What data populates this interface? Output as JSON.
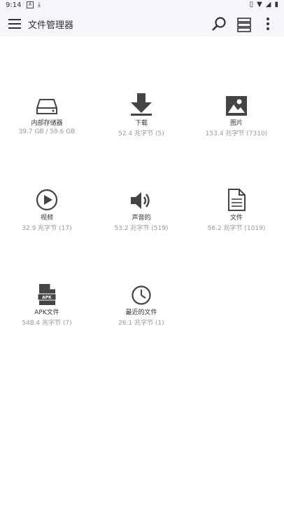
{
  "status": {
    "time": "9:14",
    "left_icons": [
      "a-badge-icon",
      "download-icon"
    ],
    "right_icons": [
      "vibrate-icon",
      "wifi-icon",
      "signal-icon",
      "battery-icon"
    ]
  },
  "appbar": {
    "title": "文件管理器",
    "icons": [
      "menu-icon",
      "search-icon",
      "layout-icon",
      "more-icon"
    ]
  },
  "tiles": [
    {
      "label": "内部存储器",
      "sub": "39.7 GB / 59.6 GB",
      "icon": "drive-icon"
    },
    {
      "label": "下载",
      "sub": "52.4 兆字节 (5)",
      "icon": "download-icon"
    },
    {
      "label": "图片",
      "sub": "153.4 兆字节 (7310)",
      "icon": "image-icon"
    },
    {
      "label": "视频",
      "sub": "32.9 兆字节 (17)",
      "icon": "video-icon"
    },
    {
      "label": "声音的",
      "sub": "53.2 兆字节 (519)",
      "icon": "audio-icon"
    },
    {
      "label": "文件",
      "sub": "56.2 兆字节 (1019)",
      "icon": "document-icon"
    },
    {
      "label": "APK文件",
      "sub": "548.4 兆字节 (7)",
      "icon": "apk-icon",
      "badge": "APK"
    },
    {
      "label": "最近的文件",
      "sub": "26.1 兆字节 (1)",
      "icon": "clock-icon"
    }
  ]
}
